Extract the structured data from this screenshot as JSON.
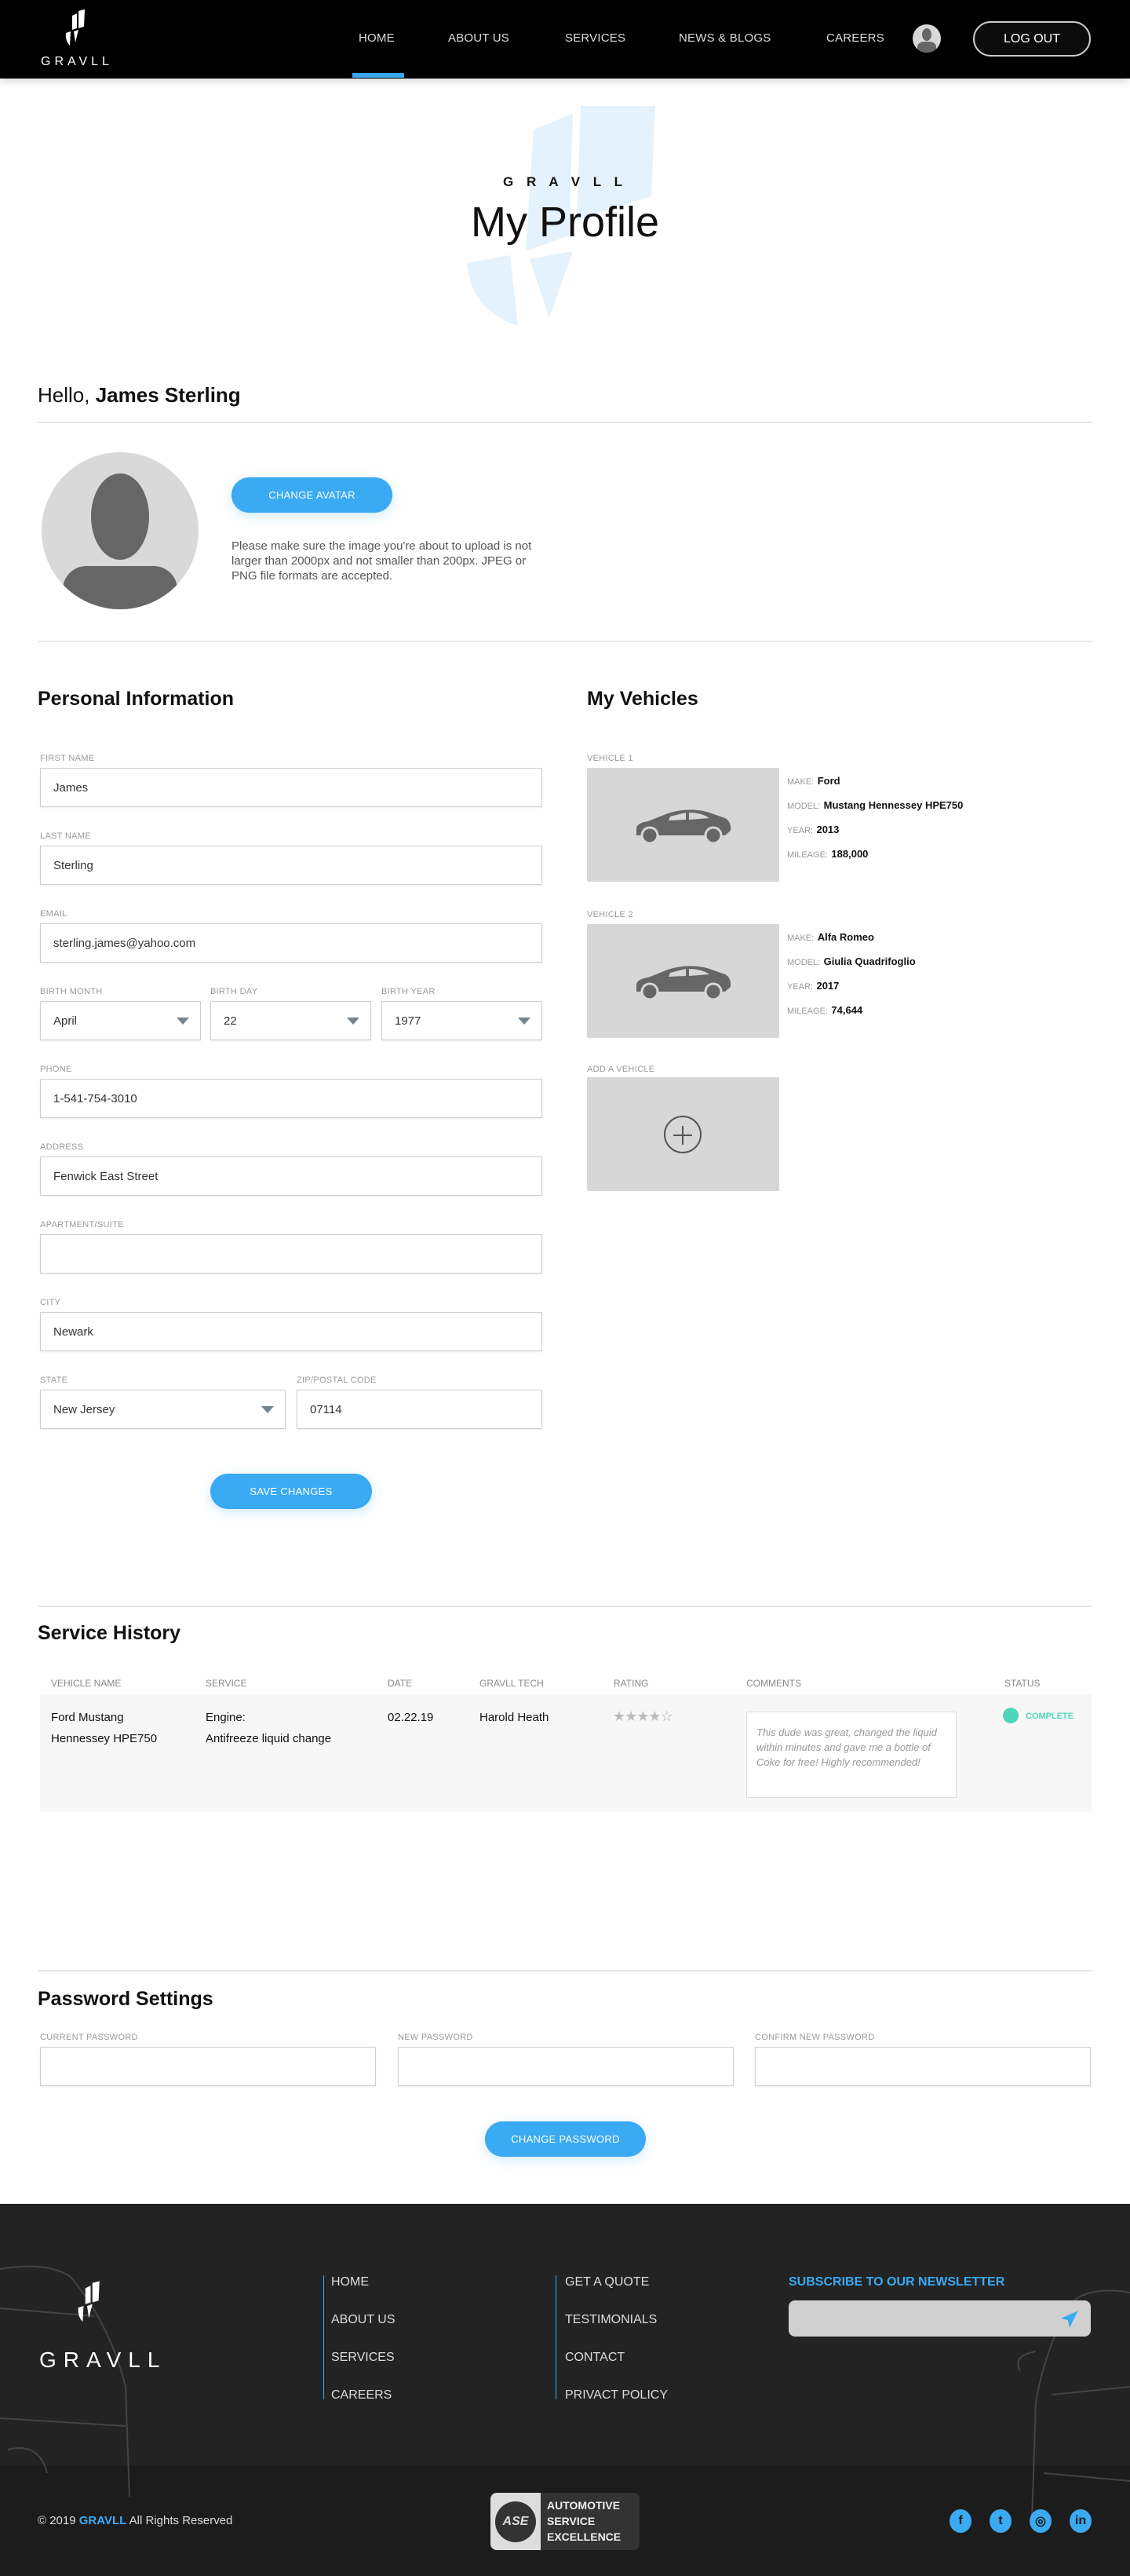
{
  "brand": {
    "name": "GRAVLL",
    "accent": "#3aaaf2"
  },
  "nav": {
    "items": [
      "HOME",
      "ABOUT US",
      "SERVICES",
      "NEWS & BLOGS",
      "CAREERS"
    ],
    "active": "HOME",
    "logout": "LOG OUT"
  },
  "hero": {
    "brand": "G R A V L L",
    "title": "My Profile"
  },
  "greeting": {
    "prefix": "Hello,",
    "name": "James Sterling"
  },
  "avatar": {
    "button": "CHANGE AVATAR",
    "note": "Please make sure the image you're about to upload is not larger than 2000px and not smaller than 200px. JPEG or PNG file formats are accepted."
  },
  "personal": {
    "title": "Personal Information",
    "first_name": {
      "label": "FIRST NAME",
      "value": "James"
    },
    "last_name": {
      "label": "LAST NAME",
      "value": "Sterling"
    },
    "email": {
      "label": "EMAIL",
      "value": "sterling.james@yahoo.com"
    },
    "birth_month": {
      "label": "BIRTH MONTH",
      "value": "April"
    },
    "birth_day": {
      "label": "BIRTH DAY",
      "value": "22"
    },
    "birth_year": {
      "label": "BIRTH YEAR",
      "value": "1977"
    },
    "phone": {
      "label": "PHONE",
      "value": "1-541-754-3010"
    },
    "address": {
      "label": "ADDRESS",
      "value": "Fenwick East Street"
    },
    "apartment": {
      "label": "APARTMENT/SUITE",
      "value": ""
    },
    "city": {
      "label": "CITY",
      "value": "Newark"
    },
    "state": {
      "label": "STATE",
      "value": "New Jersey"
    },
    "zip": {
      "label": "ZIP/POSTAL CODE",
      "value": "07114"
    },
    "save": "SAVE CHANGES"
  },
  "vehicles": {
    "title": "My Vehicles",
    "keys": {
      "make": "MAKE:",
      "model": "MODEL:",
      "year": "YEAR:",
      "mileage": "MILEAGE:"
    },
    "items": [
      {
        "label": "VEHICLE 1",
        "make": "Ford",
        "model": "Mustang Hennessey HPE750",
        "year": "2013",
        "mileage": "188,000"
      },
      {
        "label": "VEHICLE 2",
        "make": "Alfa Romeo",
        "model": "Giulia Quadrifoglio",
        "year": "2017",
        "mileage": "74,644"
      }
    ],
    "add_label": "ADD A VEHICLE"
  },
  "service": {
    "title": "Service History",
    "columns": [
      "VEHICLE NAME",
      "SERVICE",
      "DATE",
      "GRAVLL TECH",
      "RATING",
      "COMMENTS",
      "STATUS"
    ],
    "rows": [
      {
        "vehicle_1": "Ford Mustang",
        "vehicle_2": "Hennessey HPE750",
        "service_1": "Engine:",
        "service_2": "Antifreeze liquid change",
        "date": "02.22.19",
        "tech": "Harold Heath",
        "rating": 4,
        "rating_max": 5,
        "comment": "This dude was great, changed the liquid within minutes and gave me a bottle of Coke for free! Highly recommended!",
        "status": "COMPLETE",
        "status_color": "#4fd6b8"
      }
    ]
  },
  "password": {
    "title": "Password Settings",
    "current": "CURRENT PASSWORD",
    "new": "NEW PASSWORD",
    "confirm": "CONFIRM NEW PASSWORD",
    "button": "CHANGE PASSWORD"
  },
  "footer": {
    "col1": [
      "HOME",
      "ABOUT US",
      "SERVICES",
      "CAREERS"
    ],
    "col2": [
      "GET A QUOTE",
      "TESTIMONIALS",
      "CONTACT",
      "PRIVACT POLICY"
    ],
    "newsletter": "SUBSCRIBE TO OUR NEWSLETTER",
    "copyright_pre": "© 2019",
    "copyright_brand": "GRAVLL",
    "copyright_post": "All Rights Reserved",
    "badge": [
      "AUTOMOTIVE",
      "SERVICE",
      "EXCELLENCE"
    ],
    "badge_logo": "ASE CERTIFIED",
    "social": [
      "facebook",
      "twitter",
      "instagram",
      "linkedin"
    ]
  }
}
